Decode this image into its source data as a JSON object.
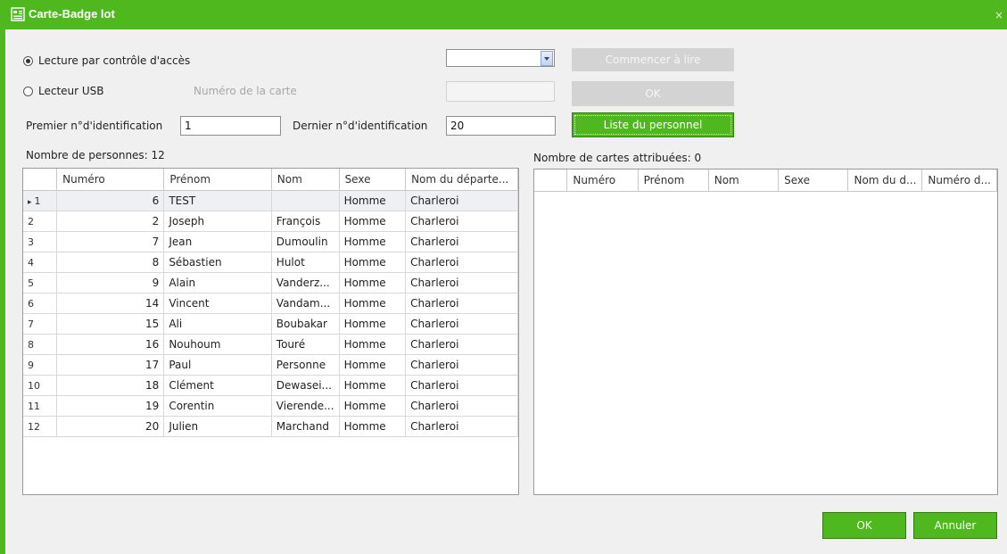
{
  "window": {
    "title": "Carte-Badge lot",
    "close_label": "×"
  },
  "mode": {
    "access_control_label": "Lecture par contrôle d'accès",
    "usb_label": "Lecteur USB",
    "card_number_label": "Numéro de la carte",
    "selected": "access_control"
  },
  "reader_select": {
    "value": ""
  },
  "card_number_input": {
    "value": ""
  },
  "buttons": {
    "start_read": "Commencer à lire",
    "ok_small": "OK",
    "personnel_list": "Liste du personnel",
    "ok": "OK",
    "cancel": "Annuler"
  },
  "id_range": {
    "first_label": "Premier n°d'identification",
    "first_value": "1",
    "last_label": "Dernier n°d'identification",
    "last_value": "20"
  },
  "persons": {
    "count_label": "Nombre de personnes: 12",
    "columns": [
      "Numéro",
      "Prénom",
      "Nom",
      "Sexe",
      "Nom du départe..."
    ],
    "rows": [
      {
        "row": "1",
        "numero": "6",
        "prenom": "TEST",
        "nom": "",
        "sexe": "Homme",
        "dept": "Charleroi"
      },
      {
        "row": "2",
        "numero": "2",
        "prenom": "Joseph",
        "nom": "François",
        "sexe": "Homme",
        "dept": "Charleroi"
      },
      {
        "row": "3",
        "numero": "7",
        "prenom": "Jean",
        "nom": "Dumoulin",
        "sexe": "Homme",
        "dept": "Charleroi"
      },
      {
        "row": "4",
        "numero": "8",
        "prenom": "Sébastien",
        "nom": "Hulot",
        "sexe": "Homme",
        "dept": "Charleroi"
      },
      {
        "row": "5",
        "numero": "9",
        "prenom": "Alain",
        "nom": "Vanderz...",
        "sexe": "Homme",
        "dept": "Charleroi"
      },
      {
        "row": "6",
        "numero": "14",
        "prenom": "Vincent",
        "nom": "Vandam...",
        "sexe": "Homme",
        "dept": "Charleroi"
      },
      {
        "row": "7",
        "numero": "15",
        "prenom": "Ali",
        "nom": "Boubakar",
        "sexe": "Homme",
        "dept": "Charleroi"
      },
      {
        "row": "8",
        "numero": "16",
        "prenom": "Nouhoum",
        "nom": "Touré",
        "sexe": "Homme",
        "dept": "Charleroi"
      },
      {
        "row": "9",
        "numero": "17",
        "prenom": "Paul",
        "nom": "Personne",
        "sexe": "Homme",
        "dept": "Charleroi"
      },
      {
        "row": "10",
        "numero": "18",
        "prenom": "Clément",
        "nom": "Dewasei...",
        "sexe": "Homme",
        "dept": "Charleroi"
      },
      {
        "row": "11",
        "numero": "19",
        "prenom": "Corentin",
        "nom": "Vierende...",
        "sexe": "Homme",
        "dept": "Charleroi"
      },
      {
        "row": "12",
        "numero": "20",
        "prenom": "Julien",
        "nom": "Marchand",
        "sexe": "Homme",
        "dept": "Charleroi"
      }
    ]
  },
  "assigned": {
    "count_label": "Nombre de cartes attribuées: 0",
    "columns": [
      "Numéro",
      "Prénom",
      "Nom",
      "Sexe",
      "Nom du d...",
      "Numéro d..."
    ],
    "rows": []
  }
}
